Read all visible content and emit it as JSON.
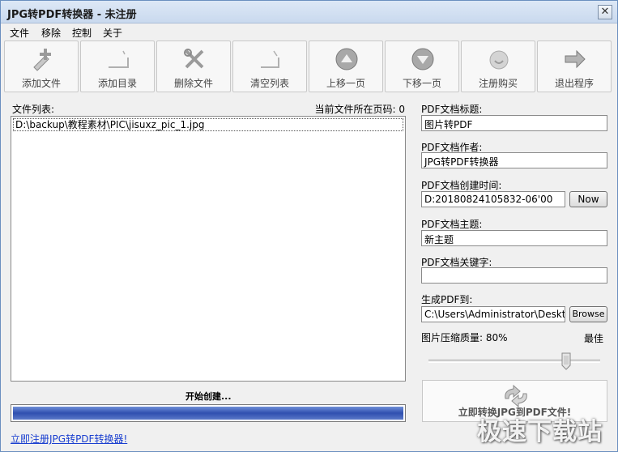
{
  "window": {
    "title": "JPG转PDF转换器 - 未注册",
    "close_glyph": "✕"
  },
  "menu": [
    "文件",
    "移除",
    "控制",
    "关于"
  ],
  "toolbar": [
    {
      "label": "添加文件",
      "icon": "add-file-icon",
      "enabled": true
    },
    {
      "label": "添加目录",
      "icon": "add-folder-icon",
      "enabled": true
    },
    {
      "label": "删除文件",
      "icon": "delete-file-icon",
      "enabled": true
    },
    {
      "label": "清空列表",
      "icon": "clear-list-icon",
      "enabled": true
    },
    {
      "label": "上移一页",
      "icon": "move-up-icon",
      "enabled": true
    },
    {
      "label": "下移一页",
      "icon": "move-down-icon",
      "enabled": true
    },
    {
      "label": "注册购买",
      "icon": "register-icon",
      "enabled": true
    },
    {
      "label": "退出程序",
      "icon": "exit-icon",
      "enabled": true
    }
  ],
  "filelist": {
    "label": "文件列表:",
    "page_label": "当前文件所在页码: 0",
    "items": [
      "D:\\backup\\教程素材\\PIC\\jisuxz_pic_1.jpg"
    ]
  },
  "pdf": {
    "title_label": "PDF文档标题:",
    "title_value": "图片转PDF",
    "author_label": "PDF文档作者:",
    "author_value": "JPG转PDF转换器",
    "date_label": "PDF文档创建时间:",
    "date_value": "D:20180824105832-06'00",
    "now_button": "Now",
    "subject_label": "PDF文档主题:",
    "subject_value": "新主题",
    "keywords_label": "PDF文档关键字:",
    "keywords_value": "",
    "output_label": "生成PDF到:",
    "output_value": "C:\\Users\\Administrator\\Desktop",
    "browse_button": "Browse"
  },
  "quality": {
    "label": "图片压缩质量: 80%",
    "best_label": "最佳",
    "value_percent": 80
  },
  "status": {
    "text": "开始创建...",
    "progress_percent": 100
  },
  "convert_button": "立即转换JPG到PDF文件!",
  "register_link": "立即注册JPG转PDF转换器!",
  "watermark": "极速下载站",
  "colors": {
    "progress": "#3a5bc0",
    "link": "#1a3fd0",
    "title_bar": "#c9d9ee"
  }
}
